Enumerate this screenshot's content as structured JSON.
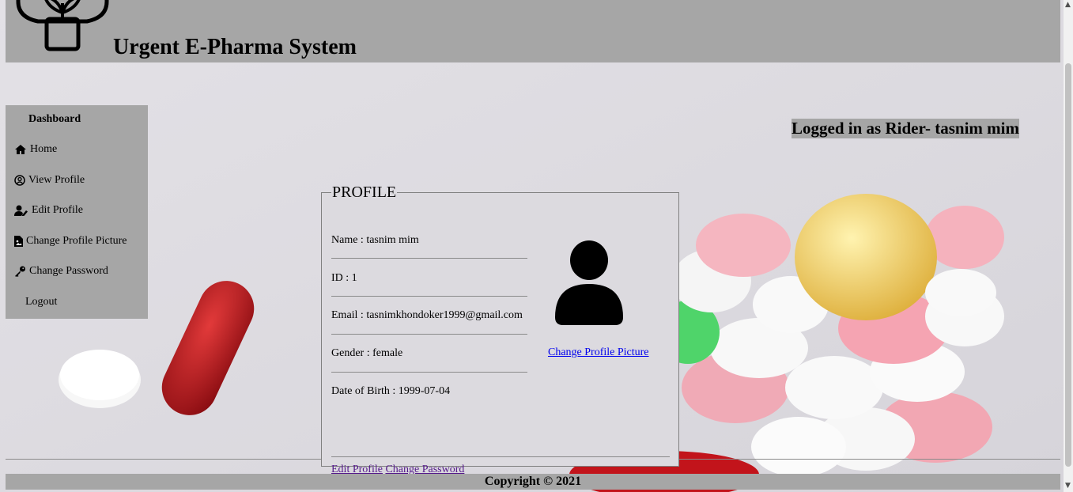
{
  "header": {
    "title": "Urgent E-Pharma System",
    "logo": "plant-pharmacy-logo"
  },
  "sidebar": {
    "heading": "Dashboard",
    "items": [
      {
        "label": "Home",
        "icon": "home-icon"
      },
      {
        "label": "View Profile",
        "icon": "user-circle-icon"
      },
      {
        "label": "Edit Profile",
        "icon": "user-edit-icon"
      },
      {
        "label": "Change Profile Picture",
        "icon": "file-image-icon"
      },
      {
        "label": "Change Password",
        "icon": "key-icon"
      },
      {
        "label": "Logout",
        "icon": ""
      }
    ]
  },
  "status": {
    "logged_in": "Logged in as Rider- tasnim mim"
  },
  "profile": {
    "legend": "PROFILE",
    "name": "Name : tasnim mim",
    "id": "ID : 1",
    "email": "Email : tasnimkhondoker1999@gmail.com",
    "gender": "Gender : female",
    "dob": "Date of Birth : 1999-07-04",
    "change_picture_link": "Change Profile Picture",
    "edit_profile_link": "Edit Profile",
    "change_password_link": "Change Password"
  },
  "footer": {
    "copyright": "Copyright © 2021"
  },
  "colors": {
    "bar_gray": "#a6a6a6",
    "link_blue": "#0000ee",
    "visited_purple": "#551a8b"
  }
}
